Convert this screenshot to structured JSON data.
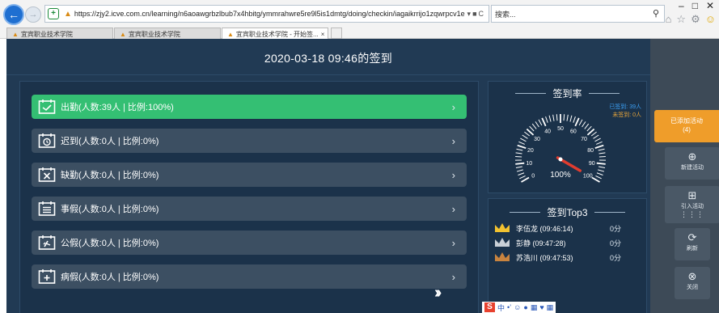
{
  "browser": {
    "url": "https://zjy2.icve.com.cn/learning/n6aoawgrbzlbub7x4hbitg/ymmrahwre5re9l5is1dmtg/doing/checkin/iagaikrrijo1zqwrpcv1e",
    "search_placeholder": "搜索...",
    "tabs": [
      {
        "label": "宜宾职业技术学院"
      },
      {
        "label": "宜宾职业技术学院"
      },
      {
        "label": "宜宾职业技术学院 - 开始签..."
      }
    ]
  },
  "page": {
    "title": "2020-03-18 09:46的签到"
  },
  "status_rows": [
    {
      "label": "出勤(人数:39人 | 比例:100%)",
      "icon": "calendar-check-icon",
      "active": true
    },
    {
      "label": "迟到(人数:0人 | 比例:0%)",
      "icon": "calendar-clock-icon",
      "active": false
    },
    {
      "label": "缺勤(人数:0人 | 比例:0%)",
      "icon": "calendar-x-icon",
      "active": false
    },
    {
      "label": "事假(人数:0人 | 比例:0%)",
      "icon": "calendar-list-icon",
      "active": false
    },
    {
      "label": "公假(人数:0人 | 比例:0%)",
      "icon": "calendar-flag-icon",
      "active": false
    },
    {
      "label": "病假(人数:0人 | 比例:0%)",
      "icon": "calendar-medical-icon",
      "active": false
    }
  ],
  "rate_panel": {
    "title": "签到率",
    "legend_signed": "已签到: 39人",
    "legend_unsigned": "未签到: 0人",
    "value_percent": 100,
    "value_label": "100%",
    "scale": [
      "0",
      "10",
      "20",
      "30",
      "40",
      "50",
      "60",
      "70",
      "80",
      "90",
      "100"
    ],
    "colors": {
      "signed": "#3b9ef2",
      "unsigned": "#e2a23b",
      "needle": "#e03c2f",
      "ticks": "#ffffff"
    }
  },
  "top3": {
    "title": "签到Top3",
    "items": [
      {
        "name": "李伍龙 (09:46:14)",
        "score": "0分",
        "crown_color": "#f2c230"
      },
      {
        "name": "彭静 (09:47:28)",
        "score": "0分",
        "crown_color": "#c9cfd6"
      },
      {
        "name": "苏浩川 (09:47:53)",
        "score": "0分",
        "crown_color": "#c9843f"
      }
    ]
  },
  "sidebar": {
    "added_activity": "已添加活动",
    "added_count": "(4)",
    "new_activity": "新建活动",
    "import_activity": "引入活动",
    "refresh": "刷新",
    "close": "关闭"
  },
  "colors": {
    "page_bg": "#213a54",
    "panel_bg": "#1b324a",
    "active_row": "#34bf73",
    "row_bg": "#3c4f62",
    "sidebar_bg": "#3d4a57",
    "accent_orange": "#ef9d2a"
  }
}
